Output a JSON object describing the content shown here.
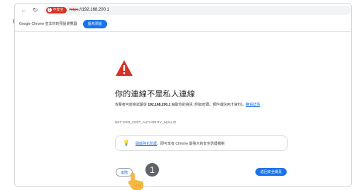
{
  "toolbar": {
    "back_icon": "arrow-left",
    "reload_icon": "reload",
    "security_chip": {
      "icon": "alert-circle",
      "label": "不安全"
    },
    "url": {
      "scheme": "https",
      "rest": "://192.168.200.1"
    }
  },
  "infobar": {
    "text": "Google Chrome 並非你的預設瀏覽器",
    "button_label": "設為預設"
  },
  "interstitial": {
    "title": "你的連線不是私人連線",
    "desc_before": "攻擊者可能會試圖從 ",
    "desc_host": "192.168.200.1",
    "desc_after": " 竊取你的資訊 (例如密碼、郵件或信用卡資料)。",
    "desc_link": "瞭解詳情",
    "error_code": "NET::ERR_CERT_AUTHORITY_INVALID",
    "promo_link": "開啟強化防護",
    "promo_text": "，即可享有 Chrome 最強大的安全防護機制",
    "details_button": "進階",
    "safe_button": "返回安全網頁"
  },
  "overlay": {
    "step_number": "1"
  },
  "colors": {
    "danger": "#d93025",
    "accent": "#1a73e8",
    "badge": "#5f6368",
    "hand": "#f5b942"
  }
}
